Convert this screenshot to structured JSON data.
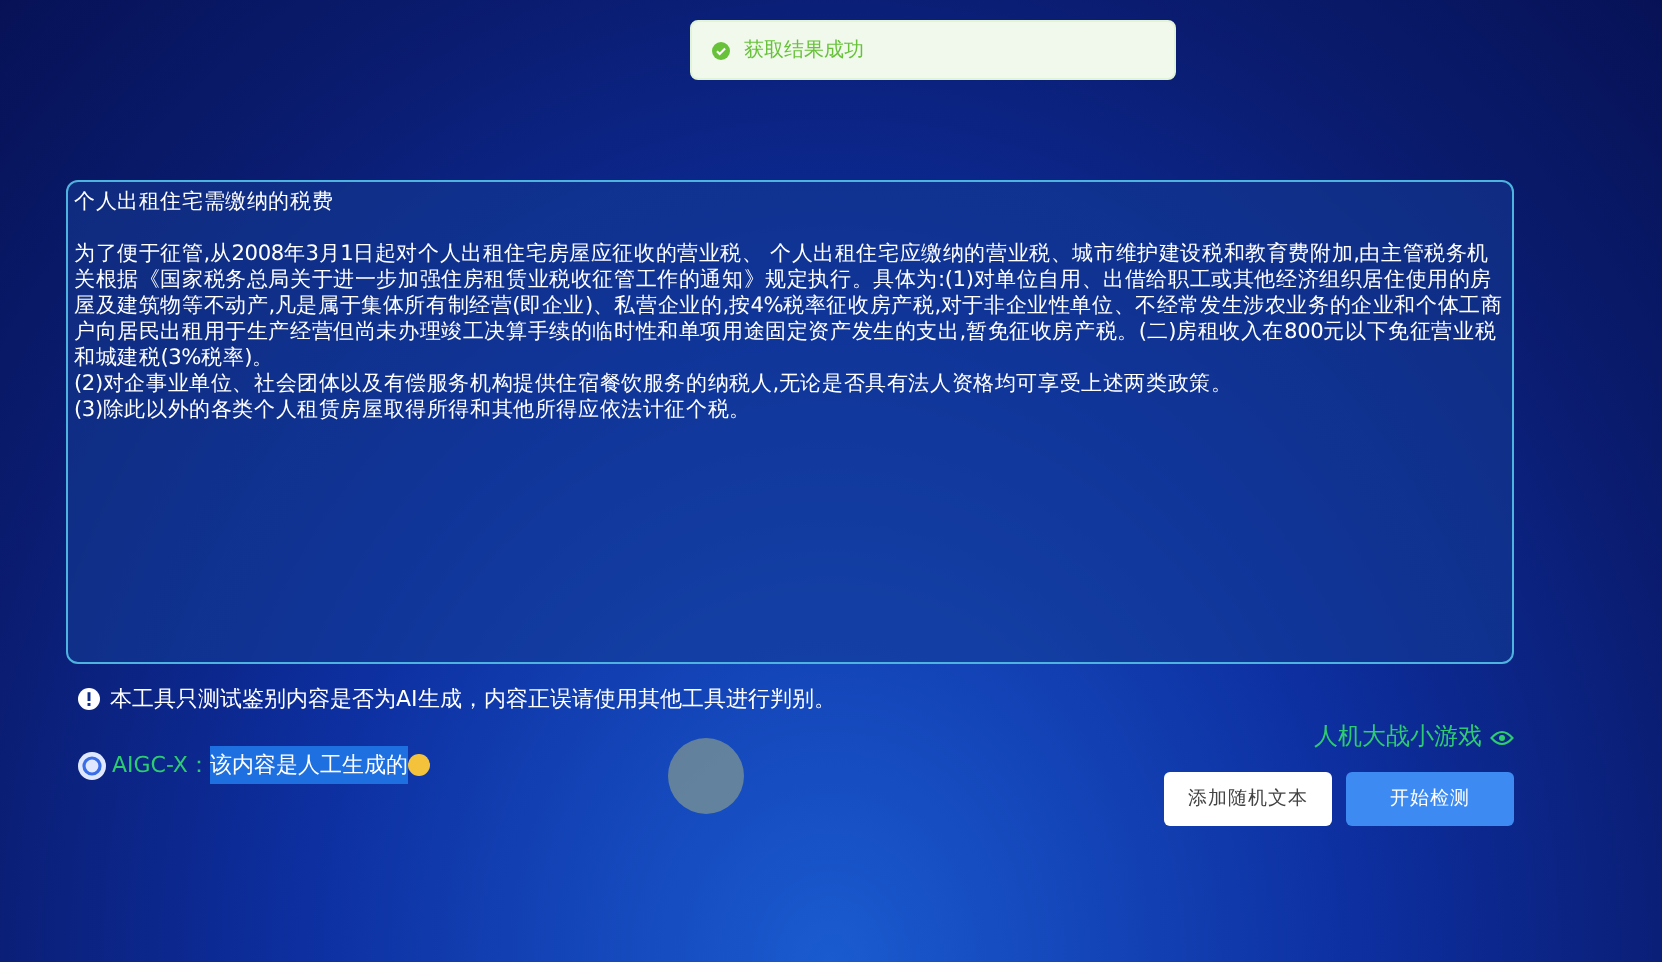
{
  "toast": {
    "message": "获取结果成功"
  },
  "text_area": {
    "heading": "个人出租住宅需缴纳的税费",
    "paragraphs": [
      "为了便于征管,从2008年3月1日起对个人出租住宅房屋应征收的营业税、 个人出租住宅应缴纳的营业税、城市维护建设税和教育费附加,由主管税务机关根据《国家税务总局关于进一步加强住房租赁业税收征管工作的通知》规定执行。具体为:(1)对单位自用、出借给职工或其他经济组织居住使用的房屋及建筑物等不动产,凡是属于集体所有制经营(即企业)、私营企业的,按4%税率征收房产税,对于非企业性单位、不经常发生涉农业务的企业和个体工商户向居民出租用于生产经营但尚未办理竣工决算手续的临时性和单项用途固定资产发生的支出,暂免征收房产税。(二)房租收入在800元以下免征营业税和城建税(3%税率)。",
      "(2)对企事业单位、社会团体以及有偿服务机构提供住宿餐饮服务的纳税人,无论是否具有法人资格均可享受上述两类政策。",
      "(3)除此以外的各类个人租赁房屋取得所得和其他所得应依法计征个税。"
    ]
  },
  "notice": "本工具只测试鉴别内容是否为AI生成，内容正误请使用其他工具进行判别。",
  "result": {
    "label": "AIGC-X：",
    "text": "该内容是人工生成的",
    "selected": true
  },
  "game_link": "人机大战小游戏",
  "buttons": [
    {
      "label": "添加随机文本",
      "kind": "secondary"
    },
    {
      "label": "开始检测",
      "kind": "primary"
    }
  ]
}
